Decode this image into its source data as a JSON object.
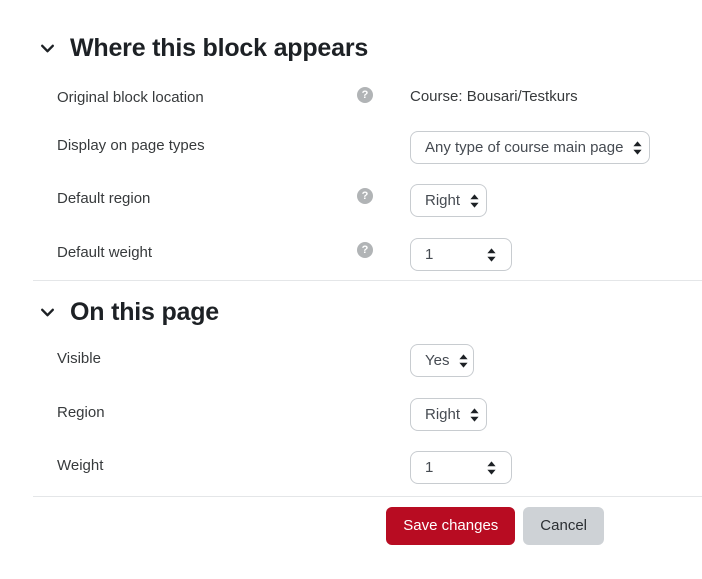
{
  "sections": [
    {
      "id": "where-this-block-appears",
      "title": "Where this block appears",
      "chevron": "chevron-down-icon",
      "rows": [
        {
          "label": "Original block location",
          "help": "?",
          "has_help": true,
          "control": "static",
          "value": "Course: Bousari/Testkurs"
        },
        {
          "label": "Display on page types",
          "help": "?",
          "has_help": false,
          "control": "select",
          "value": "Any type of course main page"
        },
        {
          "label": "Default region",
          "help": "?",
          "has_help": true,
          "control": "select",
          "value": "Right"
        },
        {
          "label": "Default weight",
          "help": "?",
          "has_help": true,
          "control": "select",
          "value": "1"
        }
      ]
    },
    {
      "id": "on-this-page",
      "title": "On this page",
      "chevron": "chevron-down-icon",
      "rows": [
        {
          "label": "Visible",
          "help": "?",
          "has_help": false,
          "control": "select",
          "value": "Yes"
        },
        {
          "label": "Region",
          "help": "?",
          "has_help": false,
          "control": "select",
          "value": "Right"
        },
        {
          "label": "Weight",
          "help": "?",
          "has_help": false,
          "control": "select",
          "value": "1"
        }
      ]
    }
  ],
  "footer": {
    "save_label": "Save changes",
    "cancel_label": "Cancel"
  },
  "colors": {
    "primary": "#b80c22",
    "secondary": "#ced2d6",
    "text": "#373a3c",
    "heading": "#1d2125",
    "border": "#c8ccd0",
    "divider": "#e4e6e8",
    "help_icon": "#b1b4b6"
  }
}
